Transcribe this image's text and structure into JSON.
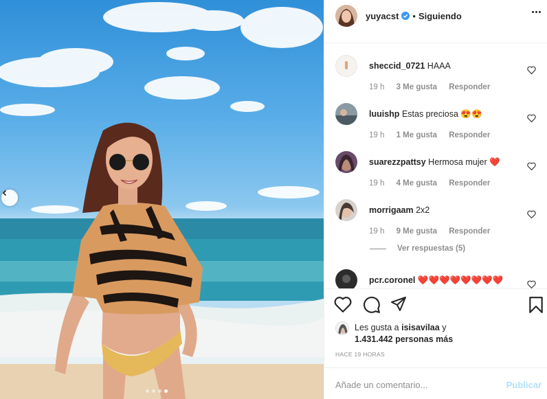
{
  "post": {
    "author": "yuyacst",
    "separator": "•",
    "follow_status": "Siguiendo",
    "carousel": {
      "dots": 4,
      "active_index": 3
    }
  },
  "comments": [
    {
      "user": "sheccid_0721",
      "text": "HAAA",
      "time": "19 h",
      "likes": "3 Me gusta",
      "reply": "Responder"
    },
    {
      "user": "luuishp",
      "text": "Estas preciosa 😍😍",
      "time": "19 h",
      "likes": "1 Me gusta",
      "reply": "Responder"
    },
    {
      "user": "suarezzpattsy",
      "text": "Hermosa mujer ❤️",
      "time": "19 h",
      "likes": "4 Me gusta",
      "reply": "Responder"
    },
    {
      "user": "morrigaam",
      "text": "2x2",
      "time": "19 h",
      "likes": "9 Me gusta",
      "reply": "Responder"
    },
    {
      "user": "pcr.coronel",
      "text": "❤️❤️❤️❤️❤️❤️❤️❤️",
      "time": "",
      "likes": "",
      "reply": ""
    }
  ],
  "view_replies": "Ver respuestas (5)",
  "likes": {
    "prefix": "Les gusta a ",
    "first_user": "isisavilaa",
    "joiner": " y",
    "count_text": "1.431.442 personas más"
  },
  "timestamp": "HACE 19 HORAS",
  "comment_box": {
    "placeholder": "Añade un comentario...",
    "publish": "Publicar"
  },
  "colors": {
    "accent_blue": "#0095f6",
    "publish_disabled": "#b2dffc",
    "heart_red": "#c0162a",
    "muted": "#8e8e8e"
  },
  "icons": [
    "chevron-left-icon",
    "verified-icon",
    "more-icon",
    "heart-icon",
    "comment-icon",
    "share-icon",
    "bookmark-icon"
  ]
}
